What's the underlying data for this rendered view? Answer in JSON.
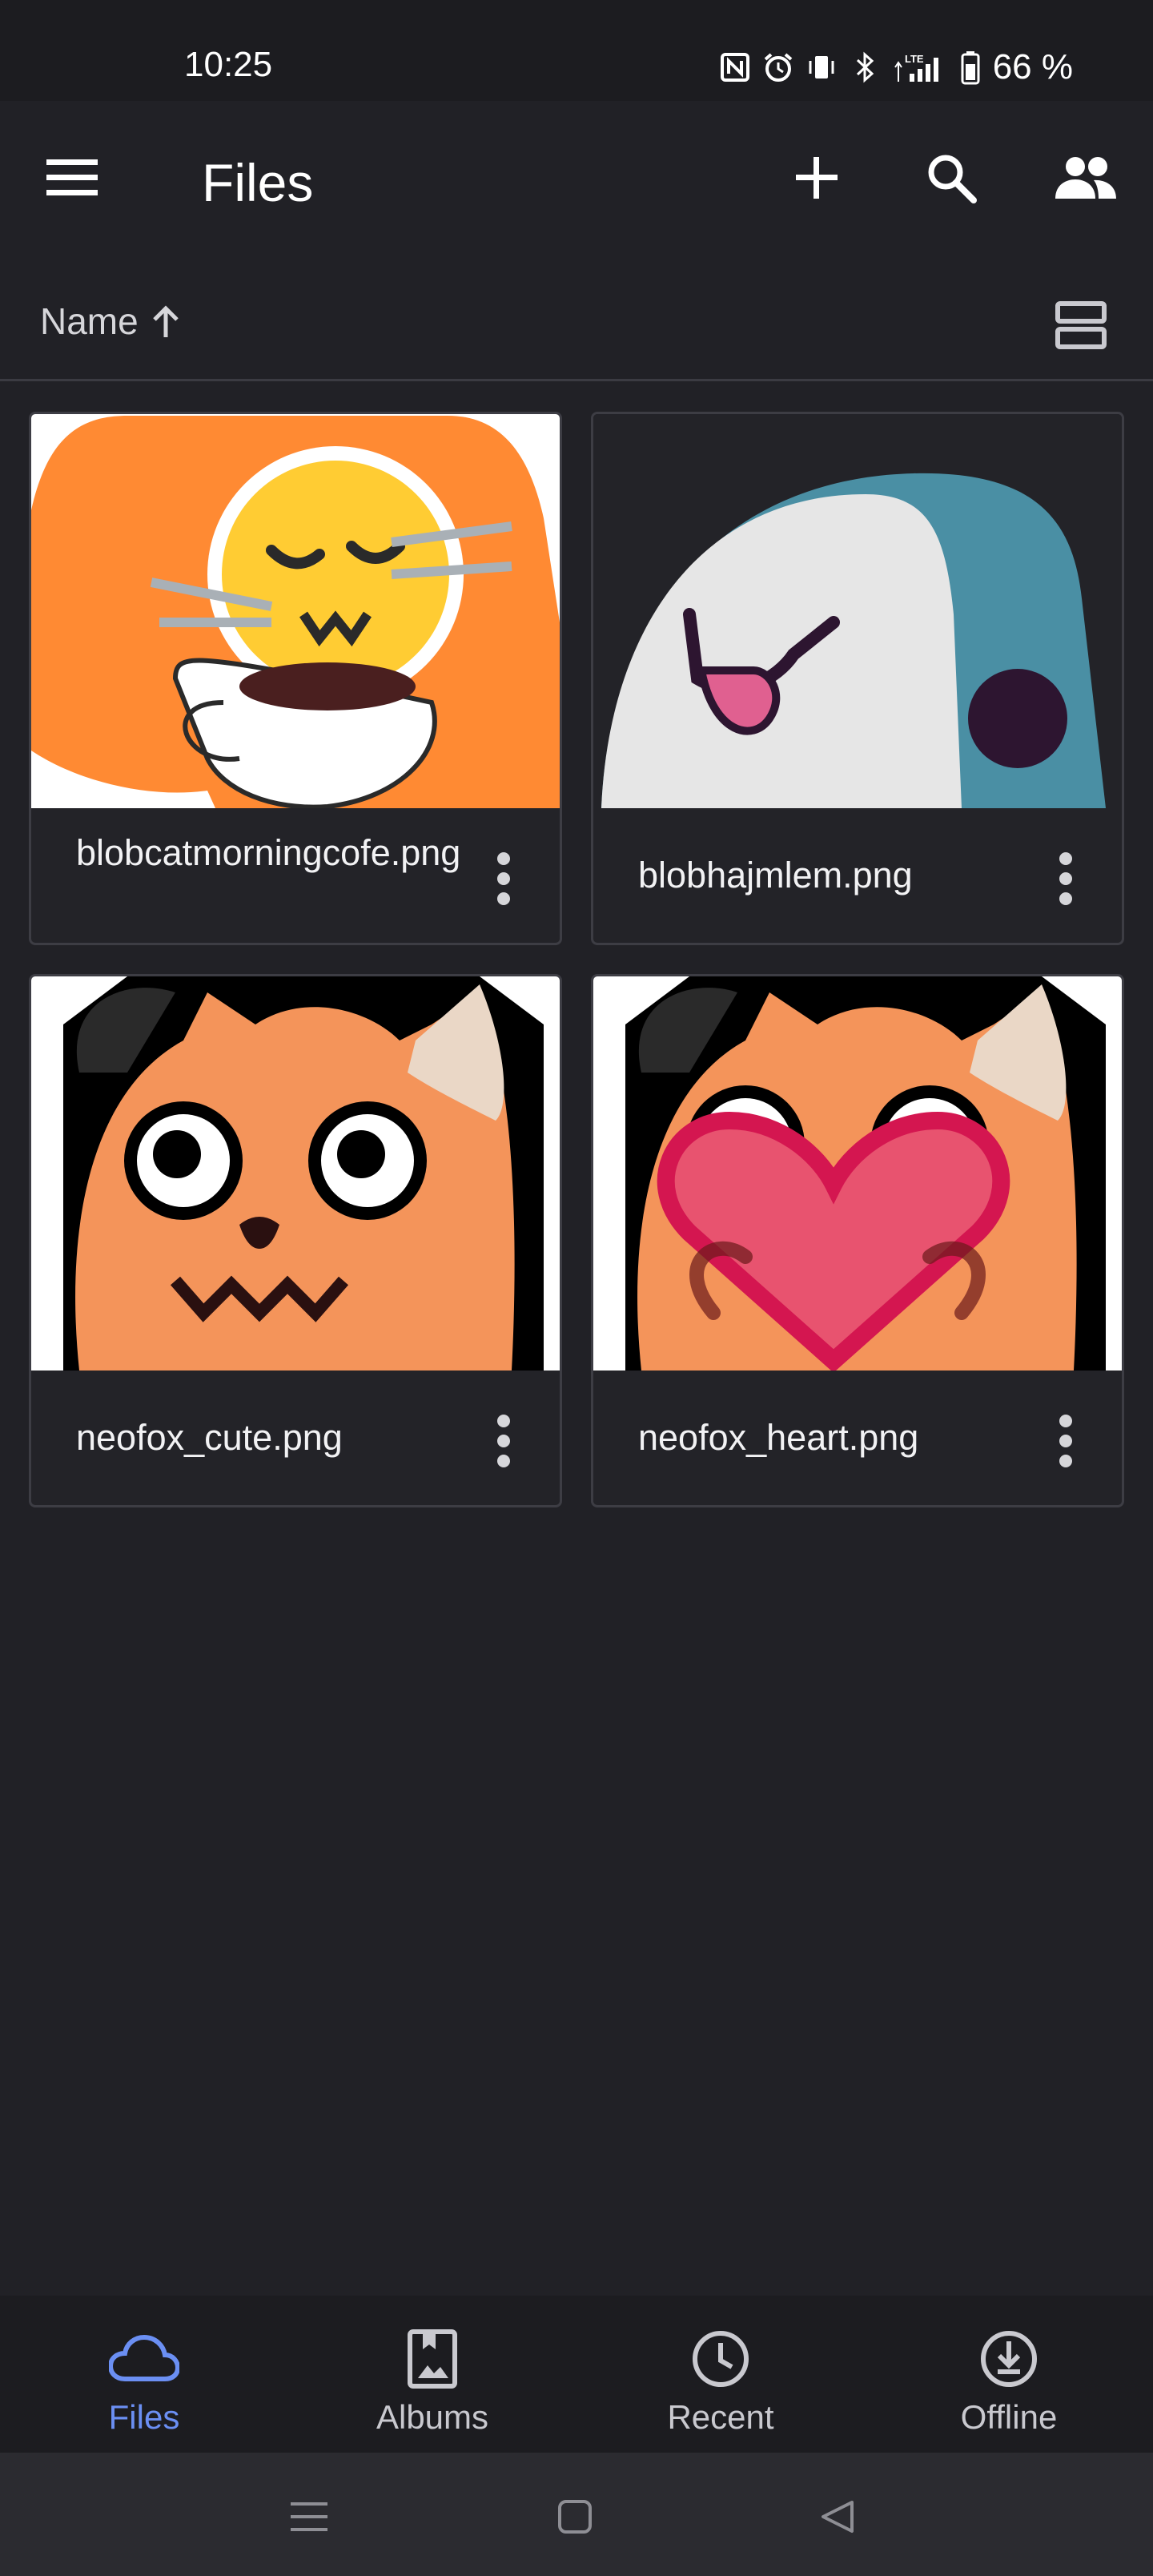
{
  "status_bar": {
    "time": "10:25",
    "battery": "66 %",
    "icons": [
      "nfc-icon",
      "alarm-icon",
      "vibrate-icon",
      "bluetooth-icon",
      "lte-signal-icon",
      "battery-icon"
    ]
  },
  "app_bar": {
    "title": "Files",
    "actions": [
      "add-icon",
      "search-icon",
      "shared-icon"
    ]
  },
  "sort": {
    "label": "Name",
    "direction_icon": "arrow-up-icon"
  },
  "files": [
    {
      "name": "blobcatmorningcofe.png"
    },
    {
      "name": "blobhajmlem.png"
    },
    {
      "name": "neofox_cute.png"
    },
    {
      "name": "neofox_heart.png"
    }
  ],
  "bottom_nav": {
    "items": [
      {
        "label": "Files",
        "icon": "cloud-icon",
        "active": true
      },
      {
        "label": "Albums",
        "icon": "album-icon",
        "active": false
      },
      {
        "label": "Recent",
        "icon": "clock-icon",
        "active": false
      },
      {
        "label": "Offline",
        "icon": "download-icon",
        "active": false
      }
    ]
  },
  "colors": {
    "background": "#212126",
    "accent": "#6b8ff3",
    "card_border": "#3d3d44"
  }
}
